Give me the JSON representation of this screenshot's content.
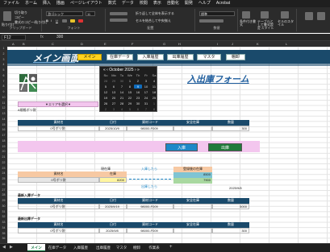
{
  "menu": [
    "ファイル",
    "ホーム",
    "挿入",
    "描画",
    "ページレイアウト",
    "数式",
    "データ",
    "校閲",
    "表示",
    "自動化",
    "開発",
    "ヘルプ",
    "Acrobat"
  ],
  "menu_active": 1,
  "ribbon": {
    "paste": "貼り付け",
    "cut": "切り取り",
    "copy": "コピー",
    "format_painter": "書式のコピー/貼り付け",
    "clipboard": "クリップボード",
    "font_name": "游ゴシック",
    "font_size": "11",
    "font_group": "フォント",
    "wrap": "折り返して全体を表示する",
    "merge": "セルを結合して中央揃え",
    "align_group": "配置",
    "number_format": "標準",
    "number_group": "数値",
    "cond_format": "条件付き書式",
    "table_format": "テーブルとして書式設定",
    "cell_style": "セルのスタイル",
    "style_group": "スタイル"
  },
  "formula": {
    "namebox": "F12",
    "fx": "fx",
    "value": "300"
  },
  "columns": [
    "A",
    "B",
    "C",
    "D",
    "E",
    "F",
    "G",
    "H",
    "I",
    "J",
    "K",
    "L"
  ],
  "rows": [
    "1",
    "2",
    "3",
    "4",
    "5",
    "6",
    "7",
    "8",
    "9",
    "10",
    "11",
    "12",
    "13",
    "14",
    "15",
    "16",
    "17",
    "18",
    "19",
    "20",
    "21",
    "22",
    "23",
    "24",
    "25",
    "26",
    "27",
    "28",
    "29",
    "30",
    "31",
    "32",
    "33",
    "34",
    "35",
    "36"
  ],
  "header": {
    "title": "メイン画面",
    "nav": [
      "メイン",
      "在庫データ",
      "入庫履歴",
      "出庫履歴",
      "マスタ",
      "棚卸"
    ],
    "nav_active": 0
  },
  "calendar": {
    "month": "October 2025",
    "weekdays": [
      "Su",
      "Mo",
      "Tu",
      "We",
      "Th",
      "Fr",
      "Sa"
    ],
    "weeks": [
      [
        "28",
        "29",
        "30",
        "1",
        "2",
        "3",
        "4"
      ],
      [
        "5",
        "6",
        "7",
        "8",
        "9",
        "10",
        "11"
      ],
      [
        "12",
        "13",
        "14",
        "15",
        "16",
        "17",
        "18"
      ],
      [
        "19",
        "20",
        "21",
        "22",
        "23",
        "24",
        "25"
      ],
      [
        "26",
        "27",
        "28",
        "29",
        "30",
        "31",
        "1"
      ],
      [
        "2",
        "3",
        "4",
        "5",
        "6",
        "7",
        "8"
      ]
    ],
    "today": "9"
  },
  "form_title": "入出庫フォーム",
  "area": {
    "label": "▼エリアを選択▼",
    "value": "A規格ボリ袋"
  },
  "main_table": {
    "headers": [
      "資材名",
      "日付",
      "資材コード",
      "安全在庫",
      "数量"
    ],
    "row": [
      "0号ボリ袋",
      "2025/10/9",
      "98000-F009",
      "",
      "300"
    ]
  },
  "actions": {
    "in": "入庫",
    "out": "出庫"
  },
  "stock_box": {
    "label": "現在庫",
    "headers": [
      "資材名",
      "在庫"
    ],
    "row": [
      "0号ボリ袋",
      "8200"
    ],
    "after_in": "入庫したら",
    "after_out": "出庫したら",
    "reg_label": "登録後の在庫",
    "reg_in": "8500",
    "reg_out": "7900",
    "date": "2025/9/8"
  },
  "recent_in": {
    "label": "最新入庫データ",
    "headers": [
      "資材名",
      "日付",
      "資材コード",
      "安全在庫",
      "数量"
    ],
    "row": [
      "0号ボリ袋",
      "2025/9/19",
      "98000-F009",
      "",
      "5000"
    ]
  },
  "recent_out": {
    "label": "最新出庫データ",
    "headers": [
      "資材名",
      "日付",
      "資材コード",
      "安全在庫",
      "数量"
    ],
    "row": [
      "0号ボリ袋",
      "2025/9/8",
      "98000-F009",
      "",
      "300"
    ]
  },
  "tabs": [
    "メイン",
    "在庫データ",
    "入庫履歴",
    "出庫履歴",
    "マスタ",
    "棚卸",
    "作業表"
  ],
  "tab_active": 0,
  "colors": {
    "navy": "#1a4a6b",
    "yellow": "#ffd21f",
    "pink": "#f3c6ee",
    "blue_btn": "#1e88c8",
    "green_btn": "#217a3b"
  }
}
